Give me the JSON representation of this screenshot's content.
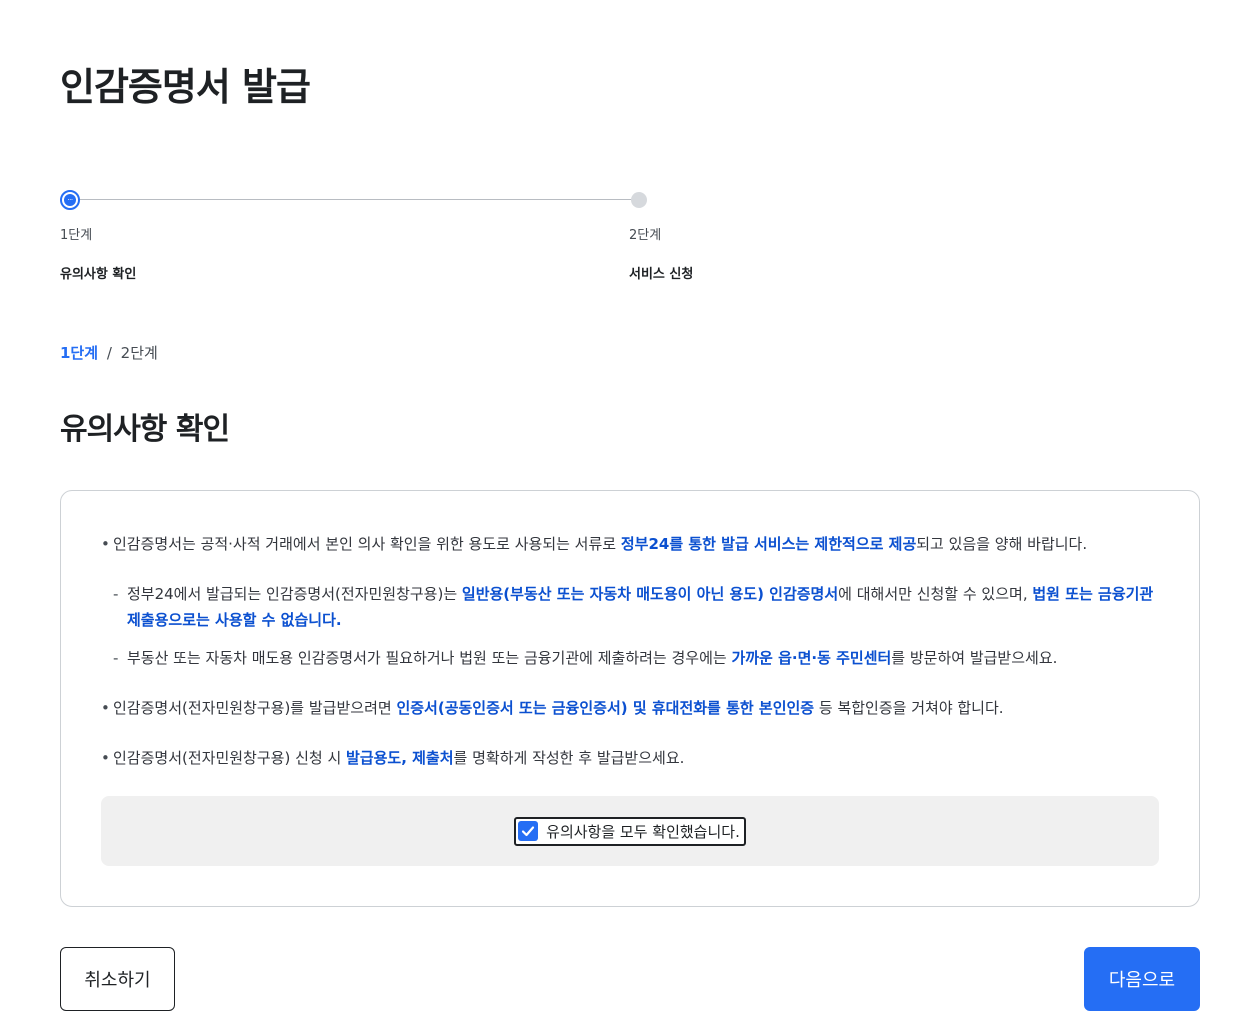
{
  "page": {
    "title": "인감증명서 발급"
  },
  "stepper": {
    "steps": [
      {
        "number": "1단계",
        "label": "유의사항 확인",
        "dot_icon_text": "···",
        "state": "active"
      },
      {
        "number": "2단계",
        "label": "서비스 신청",
        "state": "inactive"
      }
    ]
  },
  "progress": {
    "current": "1단계",
    "separator": "/",
    "total": "2단계"
  },
  "section": {
    "title": "유의사항 확인"
  },
  "notices": [
    {
      "type": "bullet",
      "parts": [
        {
          "text": "인감증명서는 공적·사적 거래에서 본인 의사 확인을 위한 용도로 사용되는 서류로 "
        },
        {
          "text": "정부24를 통한 발급 서비스는 제한적으로 제공",
          "highlight": true
        },
        {
          "text": "되고 있음을 양해 바랍니다."
        }
      ]
    },
    {
      "type": "sub",
      "parts": [
        {
          "text": "정부24에서 발급되는 인감증명서(전자민원창구용)는 "
        },
        {
          "text": "일반용(부동산 또는 자동차 매도용이 아닌 용도) 인감증명서",
          "highlight": true
        },
        {
          "text": "에 대해서만 신청할 수 있으며, "
        },
        {
          "text": "법원 또는 금융기관 제출용으로는 사용할 수 없습니다.",
          "highlight": true
        }
      ]
    },
    {
      "type": "sub",
      "last": true,
      "parts": [
        {
          "text": "부동산 또는 자동차 매도용 인감증명서가 필요하거나 법원 또는 금융기관에 제출하려는 경우에는 "
        },
        {
          "text": "가까운 읍·면·동 주민센터",
          "highlight": true
        },
        {
          "text": "를 방문하여 발급받으세요."
        }
      ]
    },
    {
      "type": "bullet",
      "parts": [
        {
          "text": "인감증명서(전자민원창구용)를 발급받으려면 "
        },
        {
          "text": "인증서(공동인증서 또는 금융인증서) 및 휴대전화를 통한 본인인증",
          "highlight": true
        },
        {
          "text": " 등 복합인증을 거쳐야 합니다."
        }
      ]
    },
    {
      "type": "bullet",
      "parts": [
        {
          "text": "인감증명서(전자민원창구용) 신청 시 "
        },
        {
          "text": "발급용도, 제출처",
          "highlight": true
        },
        {
          "text": "를 명확하게 작성한 후 발급받으세요."
        }
      ]
    }
  ],
  "confirm": {
    "label": "유의사항을 모두 확인했습니다.",
    "checked": true
  },
  "buttons": {
    "cancel": "취소하기",
    "next": "다음으로"
  },
  "colors": {
    "primary": "#256ef4",
    "highlight": "#0b50d0",
    "text": "#1e2124",
    "confirm_bg": "#f0f0f0"
  }
}
